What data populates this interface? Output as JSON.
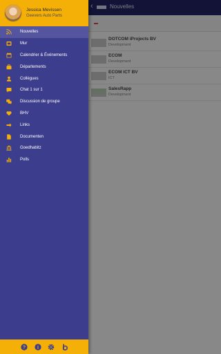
{
  "app": {
    "title": "Nouvelles",
    "items": [
      {
        "name": "DOTCOM iProjects BV",
        "dept": "Development"
      },
      {
        "name": "ECOM",
        "dept": "Development"
      },
      {
        "name": "ECOM ICT BV",
        "dept": "ICT"
      },
      {
        "name": "SalesRapp",
        "dept": "Development"
      }
    ]
  },
  "drawer": {
    "user": {
      "name": "Jessica Mevissen",
      "company": "Geevers Auto Parts"
    },
    "menu": [
      {
        "label": "Nouvelles",
        "icon": "rss-icon",
        "active": true
      },
      {
        "label": "Mur",
        "icon": "wall-icon"
      },
      {
        "label": "Calendrier & Événements",
        "icon": "calendar-icon"
      },
      {
        "label": "Départements",
        "icon": "briefcase-icon"
      },
      {
        "label": "Collègues",
        "icon": "person-icon"
      },
      {
        "label": "Chat 1 sur 1",
        "icon": "chat-icon"
      },
      {
        "label": "Discussion de groupe",
        "icon": "group-chat-icon"
      },
      {
        "label": "BHV",
        "icon": "heart-icon"
      },
      {
        "label": "Links",
        "icon": "link-icon"
      },
      {
        "label": "Documenten",
        "icon": "document-icon"
      },
      {
        "label": "Goedhabitz",
        "icon": "institution-icon"
      },
      {
        "label": "Polls",
        "icon": "bar-chart-icon"
      }
    ],
    "footer": [
      "help-icon",
      "info-icon",
      "settings-icon",
      "brand-b-icon"
    ]
  },
  "colors": {
    "accent": "#f5b008",
    "drawer": "#3d3d8d",
    "header": "#1e1f57"
  }
}
